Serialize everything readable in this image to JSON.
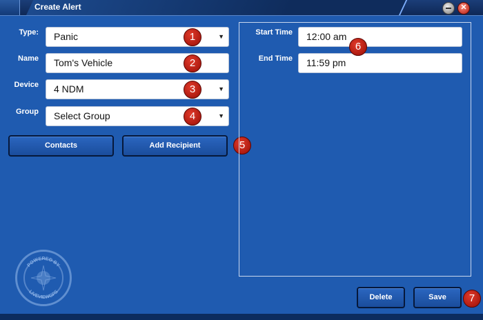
{
  "window": {
    "title": "Create Alert"
  },
  "form": {
    "type": {
      "label": "Type:",
      "value": "Panic"
    },
    "name": {
      "label": "Name",
      "value": "Tom's Vehicle"
    },
    "device": {
      "label": "Device",
      "value": "4 NDM"
    },
    "group": {
      "label": "Group",
      "value": "Select Group"
    }
  },
  "buttons": {
    "contacts": "Contacts",
    "add_recipient": "Add Recipient",
    "delete": "Delete",
    "save": "Save"
  },
  "schedule": {
    "start": {
      "label": "Start Time",
      "value": "12:00 am"
    },
    "end": {
      "label": "End Time",
      "value": "11:59 pm"
    }
  },
  "callouts": [
    "1",
    "2",
    "3",
    "4",
    "5",
    "6",
    "7"
  ],
  "logo": {
    "top_text": "POWERED BY",
    "bottom_text": "LIVEVIEWGPS"
  },
  "colors": {
    "panel": "#1f5bb0",
    "callout": "#c0150c",
    "titlebar": "#0e2856"
  }
}
